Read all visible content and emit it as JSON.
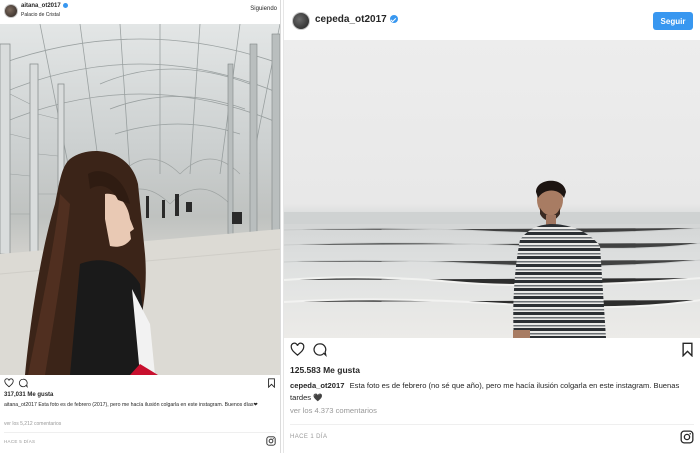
{
  "left_post": {
    "username": "aitana_ot2017",
    "location": "Palacio de Cristal",
    "follow_label": "Siguiendo",
    "likes": "317,031 Me gusta",
    "caption_user": "aitana_ot2017",
    "caption_text": "Esta foto es de febrero (2017), pero me hacía ilusión colgarla en este instagram. Buenos días❤",
    "comments_link": "ver los 5,212 comentarios",
    "time": "HACE 5 DÍAS"
  },
  "right_post": {
    "username": "cepeda_ot2017",
    "follow_label": "Seguir",
    "likes": "125.583 Me gusta",
    "caption_user": "cepeda_ot2017",
    "caption_text": "Esta foto es de febrero (no sé que año), pero me hacía ilusión colgarla en este instagram. Buenas tardes 🖤",
    "comments_link": "ver los 4.373 comentarios",
    "time": "HACE 1 DÍA"
  },
  "icons": {
    "like": "heart-icon",
    "comment": "comment-bubble-icon",
    "save": "bookmark-icon",
    "verified": "verified-badge-icon",
    "instagram": "instagram-logo-icon"
  },
  "colors": {
    "accent": "#3897f0",
    "text": "#262626",
    "muted": "#999999"
  }
}
